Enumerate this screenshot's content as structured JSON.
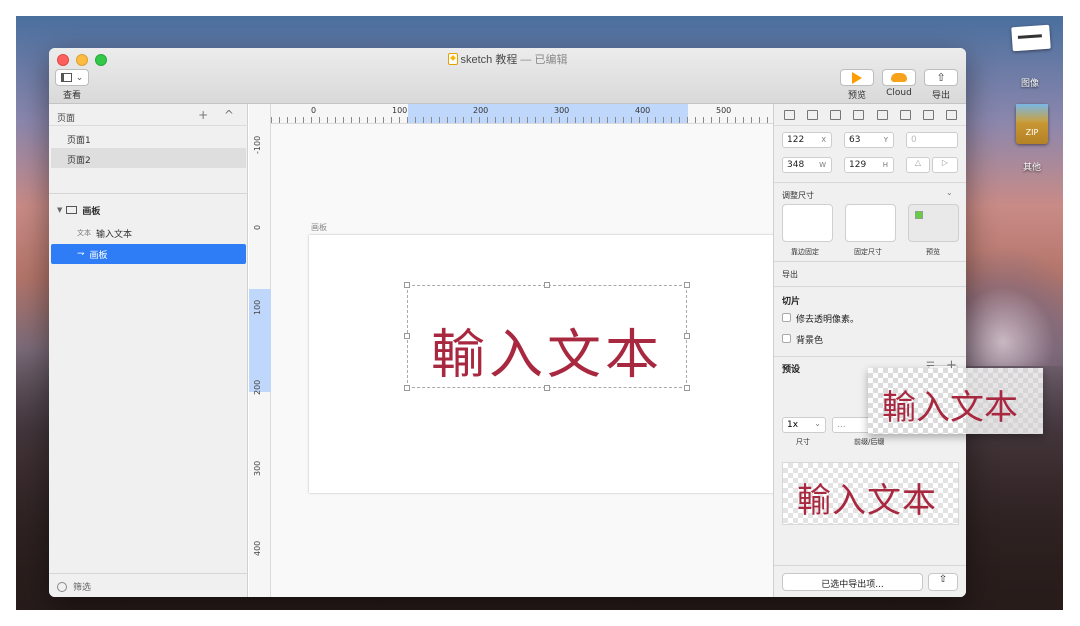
{
  "window": {
    "title": "sketch 教程",
    "edited_suffix": " — 已编辑"
  },
  "toolbar": {
    "view_label": "查看",
    "preview_label": "预览",
    "cloud_label": "Cloud",
    "export_label": "导出",
    "icons": [
      "sidebar-toggle-icon",
      "play-icon",
      "cloud-icon",
      "share-icon"
    ],
    "colors": {
      "accent": "#fd9d00",
      "cloud": "#f7a21b"
    }
  },
  "pages_panel": {
    "header": "页面",
    "controls": "+ ^",
    "pages": [
      "页面1",
      "页面2"
    ],
    "selected_page": "页面2"
  },
  "layers_panel": {
    "artboard_group": "画板",
    "items": [
      {
        "kind": "文本",
        "name": "输入文本"
      },
      {
        "kind": "⇁",
        "name": "画板"
      }
    ],
    "filter_label": "筛选",
    "colors": {
      "selection": "#2f7df6"
    }
  },
  "rulers": {
    "horizontal": [
      "0",
      "100",
      "200",
      "300",
      "400",
      "500"
    ],
    "vertical": [
      "-100",
      "0",
      "100",
      "200",
      "300",
      "400"
    ]
  },
  "canvas": {
    "artboard_label": "画板",
    "text_content": "輸入文本",
    "colors": {
      "text": "#a82840"
    }
  },
  "inspector": {
    "x": {
      "value": "122",
      "unit": "X"
    },
    "y": {
      "value": "63",
      "unit": "Y"
    },
    "rotation": "0",
    "w": {
      "value": "348",
      "unit": "W"
    },
    "h": {
      "value": "129",
      "unit": "H"
    },
    "resize_title": "调整尺寸",
    "resize_options": [
      "靠边固定",
      "固定尺寸",
      "预览"
    ],
    "export_title": "导出",
    "slice_title": "切片",
    "trim_label": "修去透明像素。",
    "bg_label": "背景色",
    "presets_title": "预设",
    "scale_value": "1x",
    "suffix_placeholder": "...",
    "size_label": "尺寸",
    "prefix_label": "前缀/后缀",
    "export_selected_btn": "已选中导出项...",
    "preview_text": "輸入文本"
  },
  "drag_preview": {
    "text": "輸入文本"
  },
  "desktop": {
    "items": [
      {
        "label": "图像",
        "icon": "image-file-icon"
      },
      {
        "label": "其他",
        "icon": "zip-file-icon",
        "badge": "ZIP"
      }
    ]
  }
}
